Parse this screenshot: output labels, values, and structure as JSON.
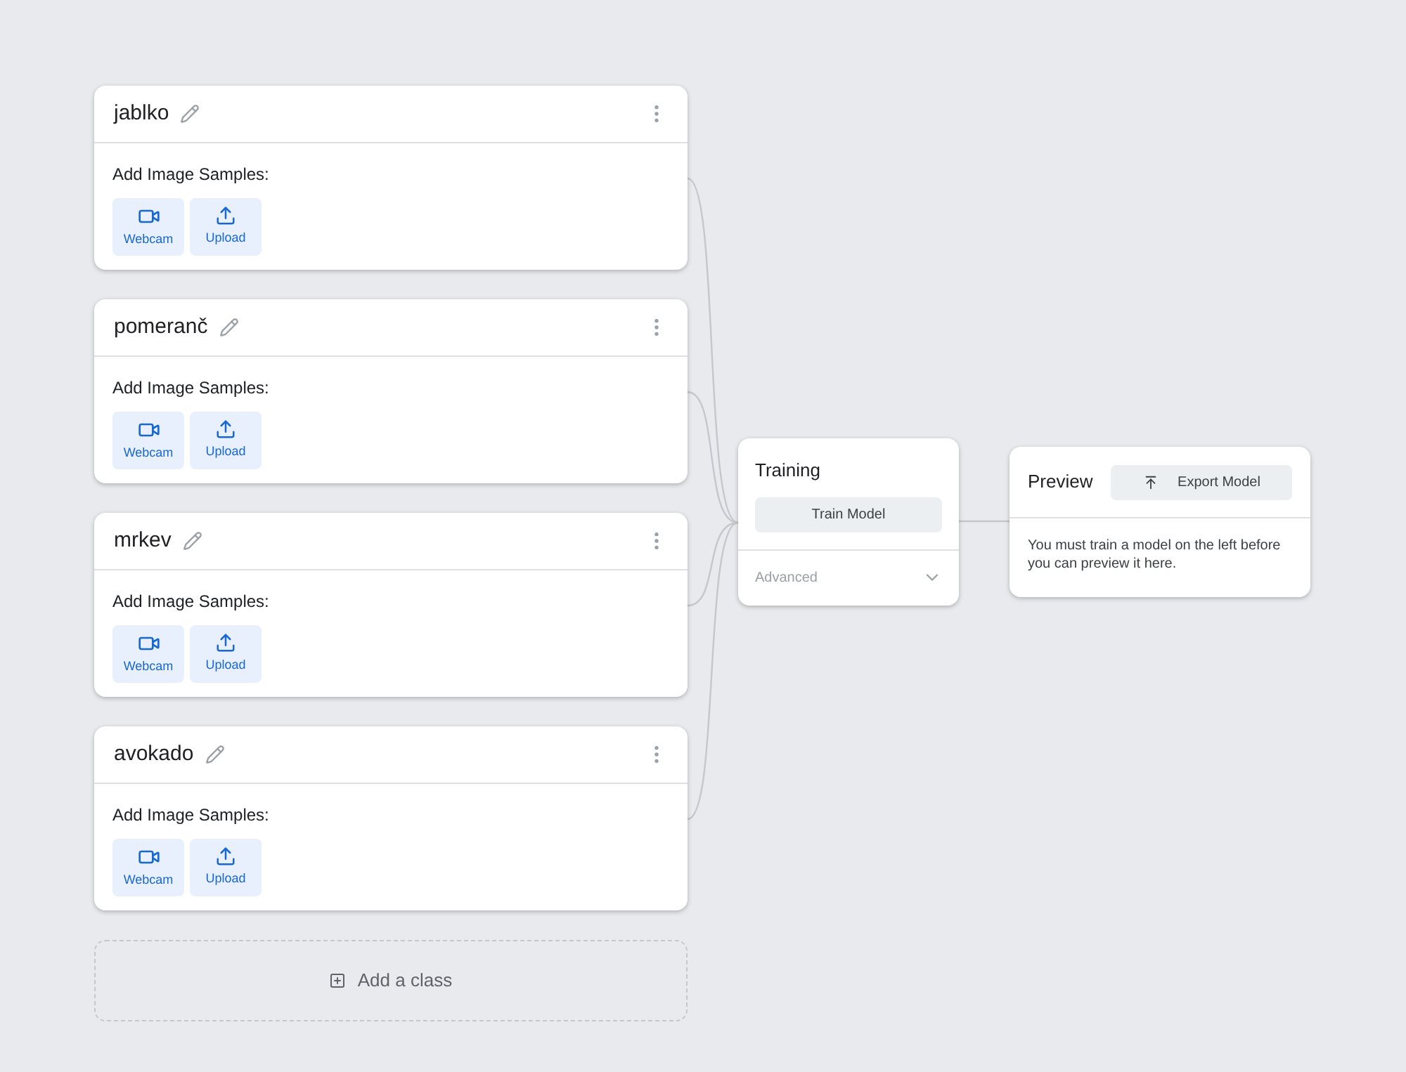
{
  "classes": [
    {
      "name": "jablko",
      "samples_label": "Add Image Samples:",
      "buttons": [
        {
          "kind": "webcam",
          "label": "Webcam"
        },
        {
          "kind": "upload",
          "label": "Upload"
        }
      ]
    },
    {
      "name": "pomeranč",
      "samples_label": "Add Image Samples:",
      "buttons": [
        {
          "kind": "webcam",
          "label": "Webcam"
        },
        {
          "kind": "upload",
          "label": "Upload"
        }
      ]
    },
    {
      "name": "mrkev",
      "samples_label": "Add Image Samples:",
      "buttons": [
        {
          "kind": "webcam",
          "label": "Webcam"
        },
        {
          "kind": "upload",
          "label": "Upload"
        }
      ]
    },
    {
      "name": "avokado",
      "samples_label": "Add Image Samples:",
      "buttons": [
        {
          "kind": "webcam",
          "label": "Webcam"
        },
        {
          "kind": "upload",
          "label": "Upload"
        }
      ]
    }
  ],
  "add_class": "Add a class",
  "training": {
    "title": "Training",
    "button": "Train Model",
    "advanced": {
      "label": "Advanced",
      "expanded": false
    }
  },
  "preview": {
    "title": "Preview",
    "export_button": "Export Model",
    "message": "You must train a model on the left before you can preview it here."
  }
}
